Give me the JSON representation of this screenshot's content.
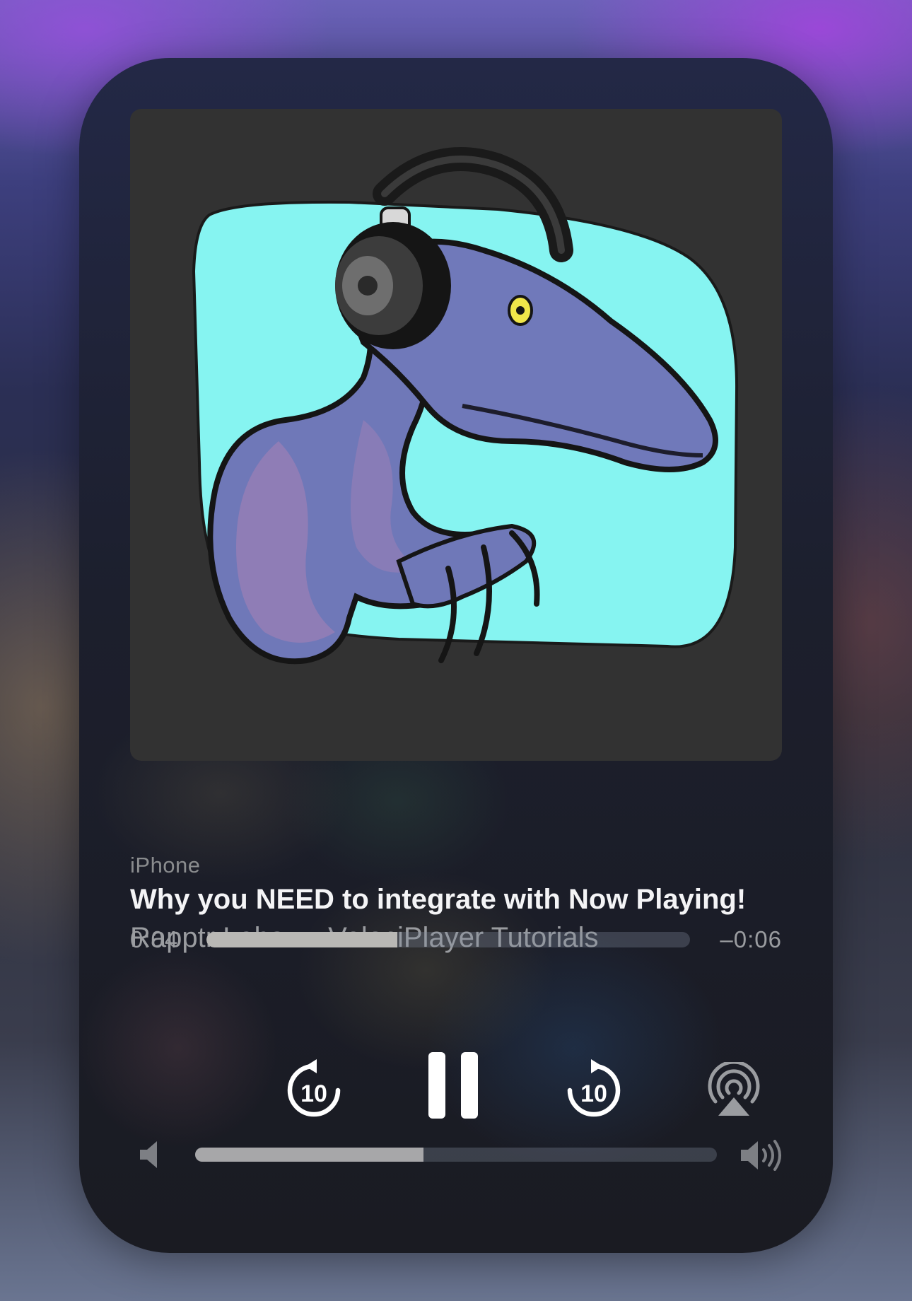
{
  "player": {
    "device_label": "iPhone",
    "title": "Why you NEED to integrate with Now Playing!",
    "subtitle": "Rapptr Labs — VelociPlayer Tutorials",
    "elapsed": "0:04",
    "remaining": "–0:06",
    "progress_fraction": 0.395,
    "volume_fraction": 0.437,
    "skip_back_seconds": "10",
    "skip_forward_seconds": "10"
  },
  "controls": {
    "skip_back_icon": "gobackward-10-icon",
    "play_pause_icon": "pause-icon",
    "skip_forward_icon": "goforward-10-icon",
    "airplay_icon": "airplay-audio-icon",
    "volume_min_icon": "speaker-icon",
    "volume_max_icon": "speaker-wave-icon"
  },
  "colors": {
    "artwork_background": "#323232",
    "artwork_backdrop": "#86f4f1",
    "raptor_body": "#6f78b8",
    "raptor_belly": "#9a7fb5"
  }
}
